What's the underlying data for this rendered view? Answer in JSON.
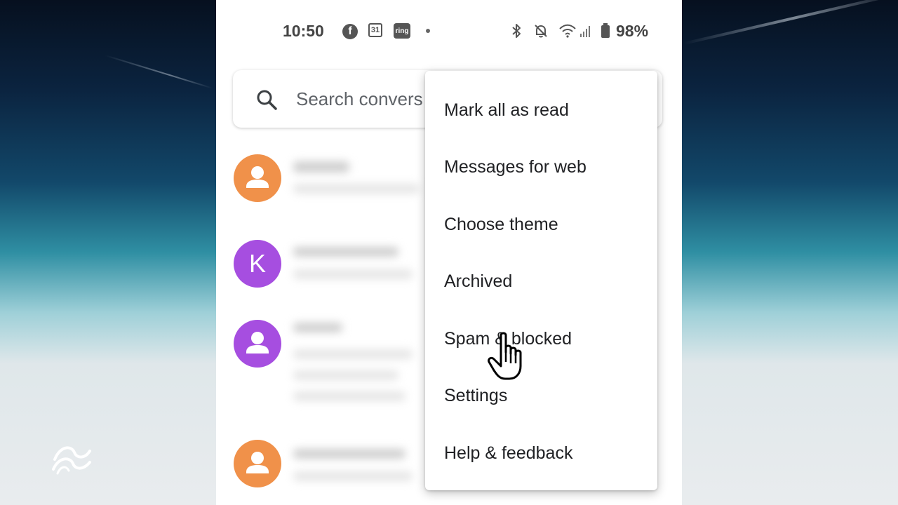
{
  "status_bar": {
    "time": "10:50",
    "notification_icons": [
      "facebook-icon",
      "calendar-icon",
      "ring-icon",
      "dot-icon"
    ],
    "calendar_day": "31",
    "ring_label": "ring",
    "system_icons": [
      "bluetooth-icon",
      "silent-icon",
      "wifi-icon",
      "signal-icon",
      "battery-icon"
    ],
    "battery_percent": "98%"
  },
  "search": {
    "placeholder": "Search convers",
    "icon": "search-icon"
  },
  "conversations": [
    {
      "avatar_type": "person-icon",
      "avatar_color": "#f0914a"
    },
    {
      "avatar_letter": "K",
      "avatar_color": "#a64ee0"
    },
    {
      "avatar_type": "person-icon",
      "avatar_color": "#a64ee0"
    },
    {
      "avatar_type": "person-icon",
      "avatar_color": "#f0914a"
    }
  ],
  "overflow_menu": {
    "items": [
      {
        "label": "Mark all as read"
      },
      {
        "label": "Messages for web"
      },
      {
        "label": "Choose theme"
      },
      {
        "label": "Archived"
      },
      {
        "label": "Spam & blocked"
      },
      {
        "label": "Settings"
      },
      {
        "label": "Help & feedback"
      }
    ]
  },
  "overlay": {
    "cursor": "hand-pointer-icon",
    "watermark": "wave-logo"
  },
  "colors": {
    "avatar_orange": "#f0914a",
    "avatar_purple": "#a64ee0",
    "menu_text": "#202124",
    "placeholder_text": "#5f6368"
  }
}
